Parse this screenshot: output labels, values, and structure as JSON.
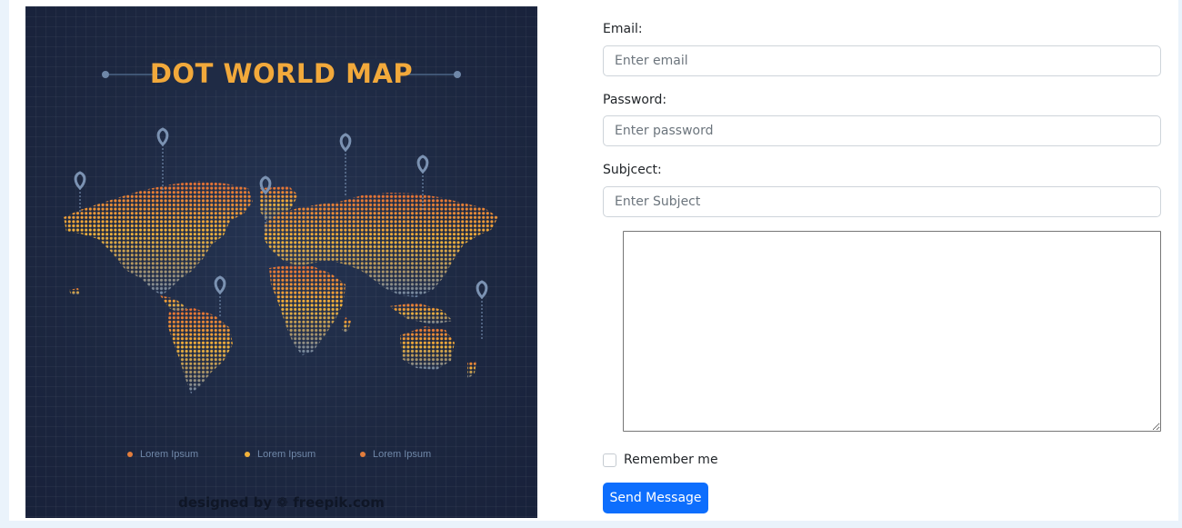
{
  "map": {
    "title": "DOT WORLD MAP",
    "legend": [
      {
        "label": "Lorem Ipsum",
        "color": "#e27d3c"
      },
      {
        "label": "Lorem Ipsum",
        "color": "#f2b23a"
      },
      {
        "label": "Lorem Ipsum",
        "color": "#e27d3c"
      }
    ],
    "credit": "designed by ❁ freepik.com",
    "colors": {
      "background": "#1d2841",
      "title": "#f2a93b",
      "dots_top": "#e67a35",
      "dots_mid": "#f2b23a",
      "dots_bottom": "#6f87a8",
      "pin": "#6f87a8"
    }
  },
  "form": {
    "email": {
      "label": "Email:",
      "placeholder": "Enter email",
      "value": ""
    },
    "password": {
      "label": "Password:",
      "placeholder": "Enter password",
      "value": ""
    },
    "subject": {
      "label": "Subjcect:",
      "placeholder": "Enter Subject",
      "value": ""
    },
    "message": {
      "value": ""
    },
    "remember": {
      "label": "Remember me",
      "checked": false
    },
    "submit": {
      "label": "Send Message",
      "color": "#0d6efd"
    }
  }
}
